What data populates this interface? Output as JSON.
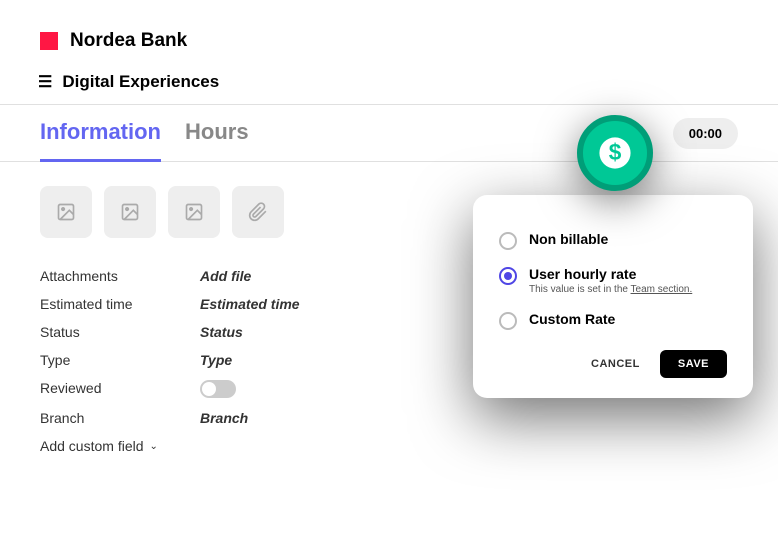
{
  "header": {
    "bank_name": "Nordea Bank",
    "sub_title": "Digital Experiences"
  },
  "tabs": {
    "info": "Information",
    "hours": "Hours"
  },
  "timer": {
    "value": "00:00"
  },
  "fields": {
    "attachments": {
      "label": "Attachments",
      "value": "Add file"
    },
    "estimated_time": {
      "label": "Estimated time",
      "value": "Estimated time"
    },
    "status": {
      "label": "Status",
      "value": "Status"
    },
    "type": {
      "label": "Type",
      "value": "Type"
    },
    "reviewed": {
      "label": "Reviewed"
    },
    "branch": {
      "label": "Branch",
      "value": "Branch"
    },
    "add_custom": "Add custom field"
  },
  "modal": {
    "non_billable": "Non billable",
    "user_hourly": "User hourly rate",
    "user_hourly_sub_prefix": "This value is set in the ",
    "user_hourly_sub_link": "Team section.",
    "custom_rate": "Custom Rate",
    "cancel": "CANCEL",
    "save": "SAVE"
  }
}
